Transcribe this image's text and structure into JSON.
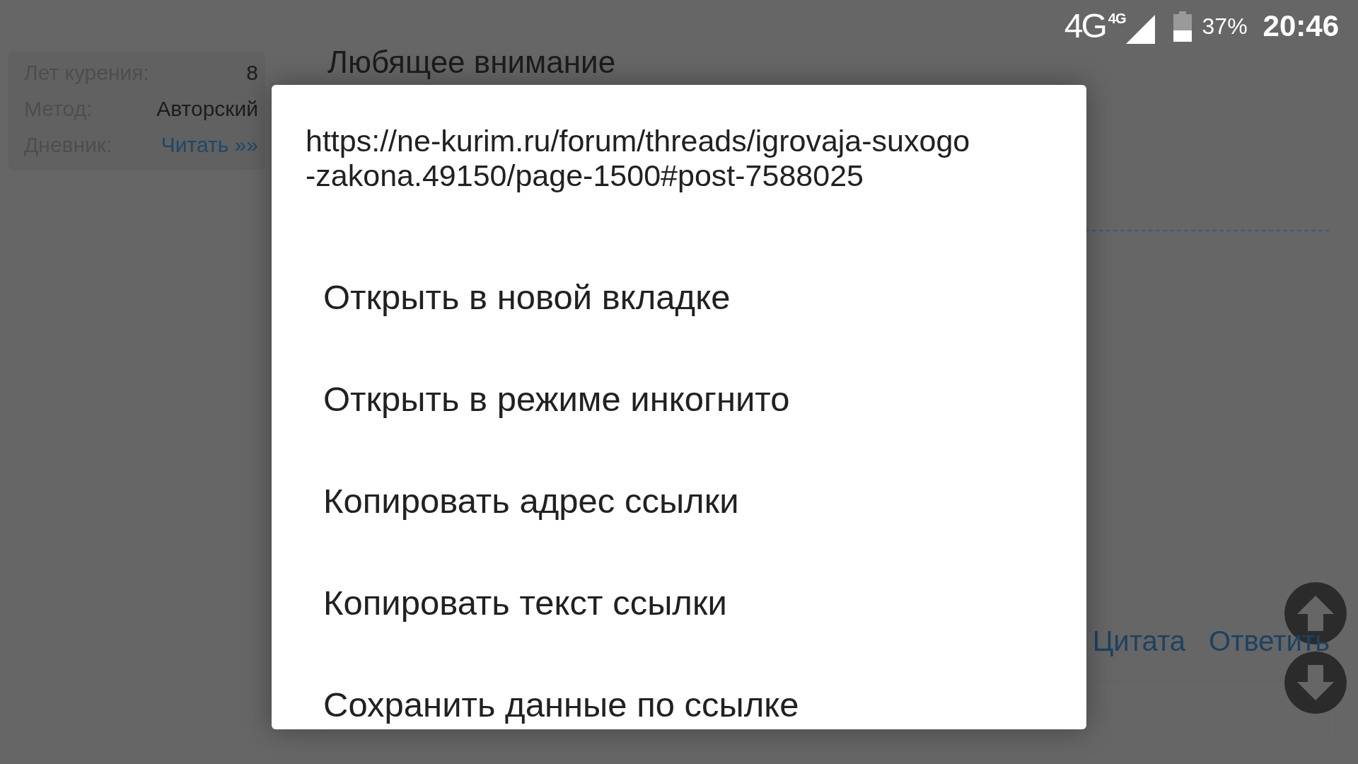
{
  "status_bar": {
    "network": "4G",
    "network_badge": "4G",
    "battery": "37%",
    "time": "20:46"
  },
  "profile_stats": [
    {
      "label": "Лет курения:",
      "value": "8",
      "kind": "text"
    },
    {
      "label": "Метод:",
      "value": "Авторский",
      "kind": "text"
    },
    {
      "label": "Дневник:",
      "value": "Читать »»",
      "kind": "link"
    }
  ],
  "post": {
    "title": "Любящее внимание",
    "actions": [
      "Цитата",
      "Ответить"
    ]
  },
  "context_menu": {
    "url_lines": [
      "https://ne-kurim.ru/forum/threads/igrovaja-suxogo",
      "-zakona.49150/page-1500#post-7588025"
    ],
    "items": [
      {
        "label": "Открыть в новой вкладке"
      },
      {
        "label": "Открыть в режиме инкогнито"
      },
      {
        "label": "Копировать адрес ссылки"
      },
      {
        "label": "Копировать текст ссылки"
      },
      {
        "label": "Сохранить данные по ссылке"
      }
    ]
  }
}
